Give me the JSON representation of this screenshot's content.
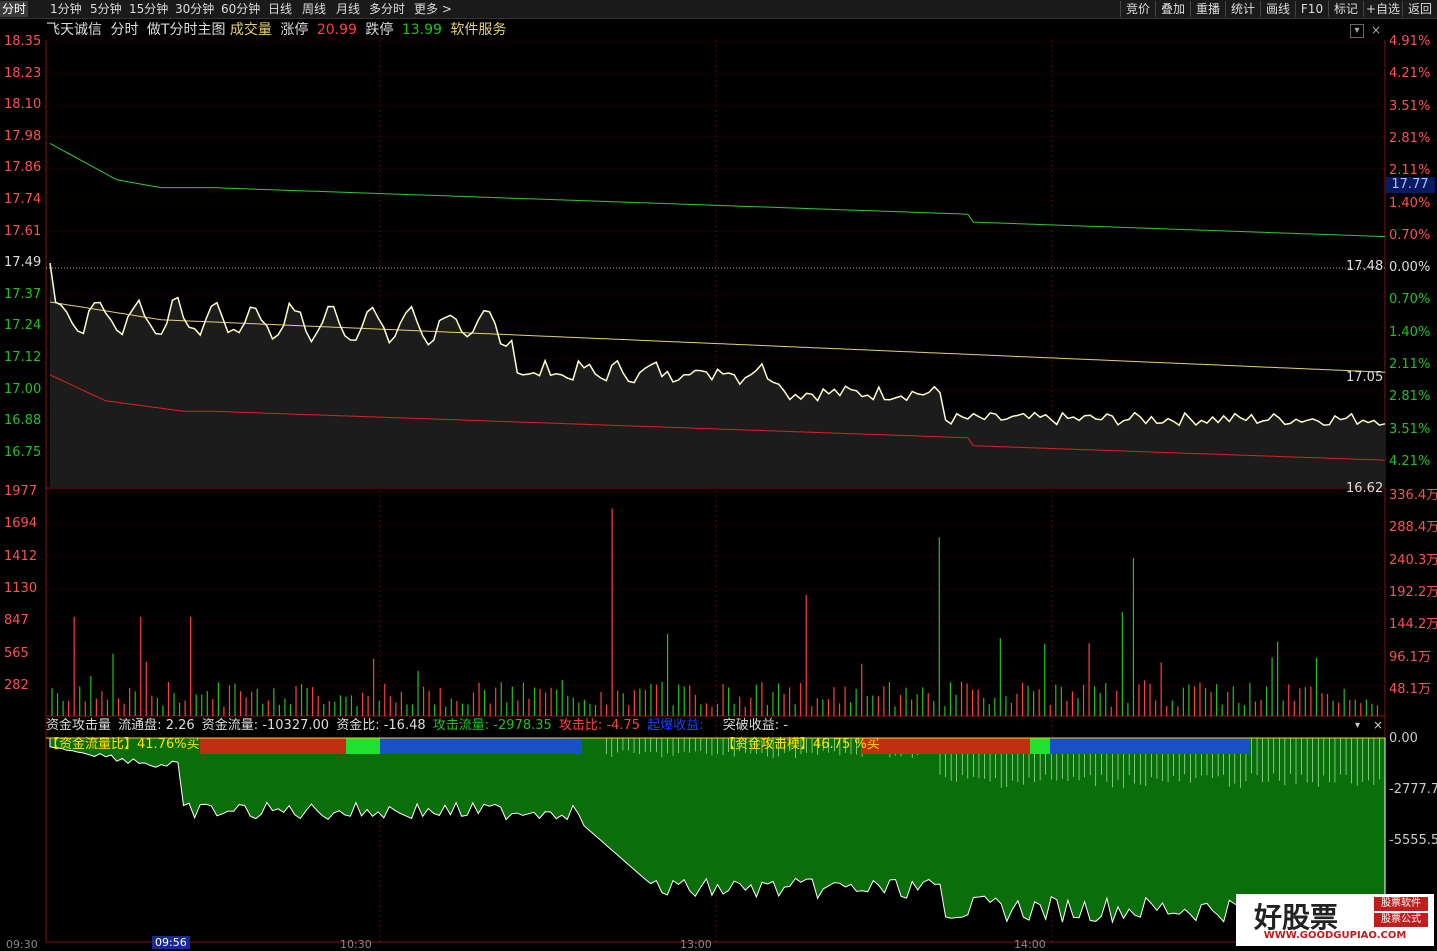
{
  "toolbar": {
    "tabs": [
      "分时",
      "1分钟",
      "5分钟",
      "15分钟",
      "30分钟",
      "60分钟",
      "日线",
      "周线",
      "月线",
      "多分时",
      "更多 >"
    ],
    "right_buttons": [
      "竞价",
      "叠加",
      "重播",
      "统计",
      "画线",
      "F10",
      "标记",
      "+自选",
      "返回"
    ]
  },
  "header": {
    "stock_name": "飞天诚信",
    "chart_mode": "分时",
    "indicator": "做T分时主图",
    "volume_label": "成交量",
    "limit_up_label": "涨停",
    "limit_up_value": "20.99",
    "limit_down_label": "跌停",
    "limit_down_value": "13.99",
    "sector": "软件服务"
  },
  "price_axis": {
    "left": [
      "18.35",
      "18.23",
      "18.10",
      "17.98",
      "17.86",
      "17.74",
      "17.61",
      "17.49",
      "17.37",
      "17.24",
      "17.12",
      "17.00",
      "16.88",
      "16.75"
    ],
    "right": [
      "4.91%",
      "4.21%",
      "3.51%",
      "2.81%",
      "2.11%",
      "1.40%",
      "0.70%",
      "0.00%",
      "0.70%",
      "1.40%",
      "2.11%",
      "2.81%",
      "3.51%",
      "4.21%"
    ],
    "current_price": "17.77",
    "line_end_labels": [
      "17.48",
      "17.05",
      "16.62"
    ]
  },
  "volume_axis": {
    "left": [
      "1977",
      "1694",
      "1412",
      "1130",
      "847",
      "565",
      "282"
    ],
    "right": [
      "336.4万",
      "288.4万",
      "240.3万",
      "192.2万",
      "144.2万",
      "96.1万",
      "48.1万"
    ]
  },
  "indicator_panel": {
    "name": "资金攻击量",
    "float_label": "流通盘:",
    "float_value": "2.26",
    "flow_label": "资金流量:",
    "flow_value": "-10327.00",
    "ratio_label": "资金比:",
    "ratio_value": "-16.48",
    "attack_label": "攻击流量:",
    "attack_value": "-2978.35",
    "attack_ratio_label": "攻击比:",
    "attack_ratio_value": "-4.75",
    "surge_label": "起爆收益:",
    "breakout_label": "突破收益:",
    "breakout_value": "-",
    "fund_ratio_tag": "【资金流量比】41.76%买",
    "attack_mode_tag": "【资金攻击模】46.75 %买",
    "right_axis": [
      "0.00",
      "-2777.7",
      "-5555.5"
    ]
  },
  "time_axis": [
    "09:30",
    "09:56",
    "10:30",
    "13:00",
    "14:00"
  ],
  "watermark": {
    "main": "好股票",
    "tag1": "股票软件",
    "tag2": "股票公式",
    "url": "WWW.GOODGUPIAO.COM"
  },
  "chart_data": {
    "type": "line",
    "ylim": [
      16.62,
      18.35
    ],
    "series": [],
    "volume_ylim": [
      0,
      1977
    ],
    "flow_ylim": [
      -6500,
      0
    ]
  },
  "colors": {
    "price_line": "#ffffc8",
    "avg_line": "#e8d070",
    "upper_band": "#2ecc2e",
    "lower_band": "#e02020",
    "up": "#ff4040",
    "down": "#22c022",
    "flow_fill": "#0a6e0a"
  }
}
